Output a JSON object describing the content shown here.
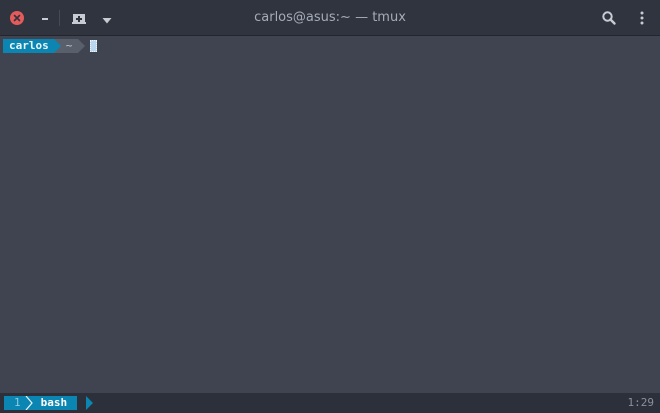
{
  "window": {
    "title": "carlos@asus:~ — tmux"
  },
  "titlebar": {
    "icons": {
      "close": "close-icon",
      "minimize": "minimize-icon",
      "new_tab": "new-tab-icon",
      "menu": "chevron-down-icon",
      "search": "search-icon",
      "more": "kebab-menu-icon"
    }
  },
  "terminal": {
    "prompt": {
      "user": "carlos",
      "directory": "~"
    }
  },
  "status": {
    "window_index": "1",
    "window_name": "bash",
    "clock": "1:29"
  },
  "colors": {
    "titlebar_bg": "#2f343f",
    "terminal_bg": "#3f4450",
    "statusbar_bg": "#2b303b",
    "accent": "#0b86b2",
    "close": "#e55b5b",
    "text_dim": "#a6acb7"
  }
}
